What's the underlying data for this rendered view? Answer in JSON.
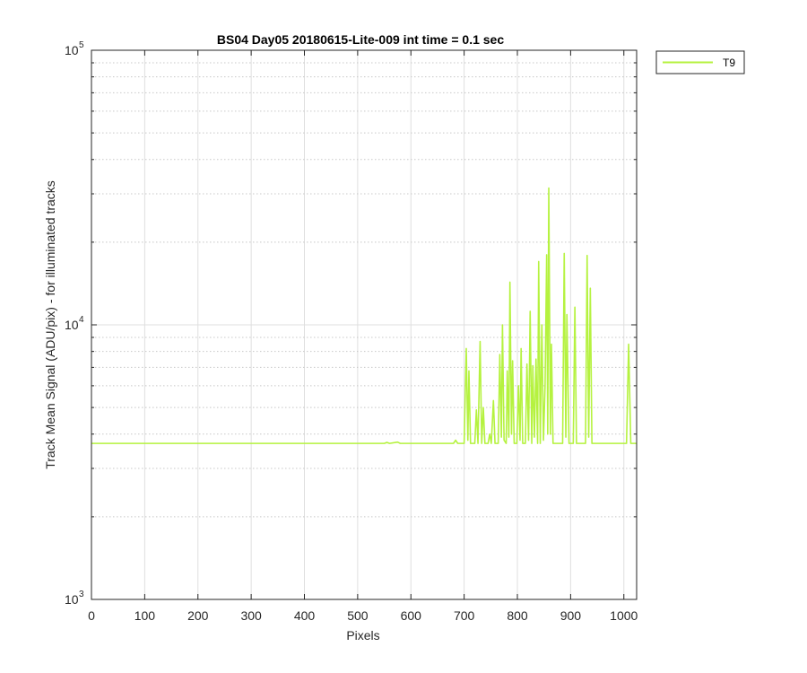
{
  "chart_data": {
    "type": "line",
    "title": "BS04 Day05 20180615-Lite-009 int time = 0.1 sec",
    "xlabel": "Pixels",
    "ylabel": "Track Mean Signal (ADU/pix) - for illuminated tracks",
    "xlim": [
      0,
      1024
    ],
    "ylim": [
      1000,
      100000
    ],
    "yscale": "log",
    "grid": true,
    "legend_position": "outside-top-right",
    "x_ticks": [
      "0",
      "100",
      "200",
      "300",
      "400",
      "500",
      "600",
      "700",
      "800",
      "900",
      "1000"
    ],
    "y_tick_labels": [
      {
        "base": "10",
        "exp": "3"
      },
      {
        "base": "10",
        "exp": "4"
      },
      {
        "base": "10",
        "exp": "5"
      }
    ],
    "series": [
      {
        "name": "T9",
        "color": "#b5f23f",
        "baseline": 3700,
        "points": [
          [
            0,
            3700
          ],
          [
            550,
            3700
          ],
          [
            555,
            3730
          ],
          [
            560,
            3700
          ],
          [
            575,
            3740
          ],
          [
            580,
            3700
          ],
          [
            680,
            3700
          ],
          [
            684,
            3800
          ],
          [
            688,
            3700
          ],
          [
            700,
            3700
          ],
          [
            704,
            8200
          ],
          [
            707,
            3800
          ],
          [
            709,
            6800
          ],
          [
            712,
            3700
          ],
          [
            720,
            3700
          ],
          [
            723,
            4900
          ],
          [
            726,
            3700
          ],
          [
            730,
            8700
          ],
          [
            733,
            3700
          ],
          [
            736,
            5000
          ],
          [
            739,
            3700
          ],
          [
            745,
            3700
          ],
          [
            748,
            4000
          ],
          [
            751,
            3700
          ],
          [
            755,
            5300
          ],
          [
            758,
            3700
          ],
          [
            764,
            3700
          ],
          [
            767,
            7800
          ],
          [
            770,
            3900
          ],
          [
            772,
            10000
          ],
          [
            775,
            3800
          ],
          [
            779,
            3700
          ],
          [
            781,
            6800
          ],
          [
            784,
            3900
          ],
          [
            786,
            14300
          ],
          [
            789,
            4000
          ],
          [
            791,
            7400
          ],
          [
            794,
            3700
          ],
          [
            799,
            3700
          ],
          [
            802,
            6000
          ],
          [
            805,
            3800
          ],
          [
            807,
            8200
          ],
          [
            810,
            3700
          ],
          [
            815,
            3700
          ],
          [
            818,
            7200
          ],
          [
            821,
            3800
          ],
          [
            824,
            11200
          ],
          [
            827,
            3700
          ],
          [
            829,
            7100
          ],
          [
            832,
            3900
          ],
          [
            835,
            7500
          ],
          [
            838,
            3700
          ],
          [
            840,
            17000
          ],
          [
            843,
            3700
          ],
          [
            846,
            10000
          ],
          [
            849,
            3800
          ],
          [
            852,
            6000
          ],
          [
            855,
            18000
          ],
          [
            857,
            4000
          ],
          [
            859,
            31500
          ],
          [
            862,
            4000
          ],
          [
            864,
            8500
          ],
          [
            867,
            3700
          ],
          [
            885,
            3700
          ],
          [
            888,
            18200
          ],
          [
            891,
            3900
          ],
          [
            893,
            10900
          ],
          [
            897,
            3700
          ],
          [
            905,
            3700
          ],
          [
            908,
            11600
          ],
          [
            911,
            3700
          ],
          [
            928,
            3700
          ],
          [
            931,
            17900
          ],
          [
            934,
            3900
          ],
          [
            937,
            13600
          ],
          [
            940,
            3700
          ],
          [
            1005,
            3700
          ],
          [
            1009,
            8500
          ],
          [
            1013,
            3700
          ],
          [
            1024,
            3700
          ]
        ]
      }
    ]
  }
}
